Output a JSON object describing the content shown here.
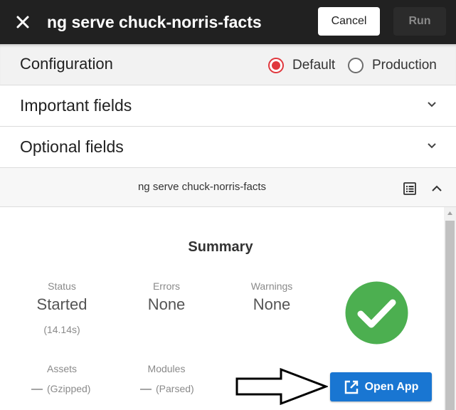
{
  "toolbar": {
    "title": "ng serve chuck-norris-facts",
    "cancel_label": "Cancel",
    "run_label": "Run",
    "close_icon": "close-icon"
  },
  "configuration": {
    "title": "Configuration",
    "options": [
      {
        "label": "Default",
        "selected": true
      },
      {
        "label": "Production",
        "selected": false
      }
    ],
    "accent_color": "#e0383e"
  },
  "sections": [
    {
      "title": "Important fields",
      "expanded": false
    },
    {
      "title": "Optional fields",
      "expanded": false
    }
  ],
  "task": {
    "name": "ng serve chuck-norris-facts",
    "log_icon": "list-icon",
    "collapse_icon": "chevron-up-icon"
  },
  "summary": {
    "title": "Summary",
    "status": {
      "label": "Status",
      "value": "Started",
      "sub": "(14.14s)"
    },
    "errors": {
      "label": "Errors",
      "value": "None"
    },
    "warnings": {
      "label": "Warnings",
      "value": "None"
    },
    "assets": {
      "label": "Assets",
      "dash": "—",
      "note": "(Gzipped)"
    },
    "modules": {
      "label": "Modules",
      "dash": "—",
      "note": "(Parsed)"
    },
    "success_color": "#4caf50"
  },
  "open_app": {
    "label": "Open App",
    "icon": "open-in-new-icon",
    "color": "#1976d2"
  }
}
